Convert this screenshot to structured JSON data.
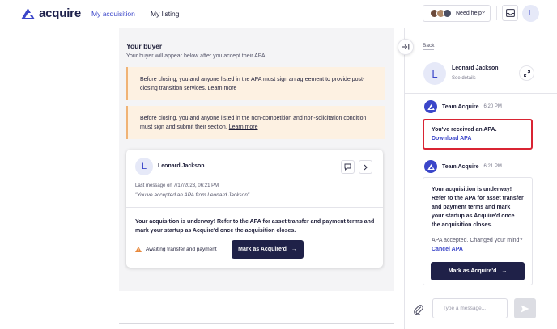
{
  "nav": {
    "brand": "acquire",
    "links": [
      {
        "label": "My acquisition",
        "active": true
      },
      {
        "label": "My listing",
        "active": false
      }
    ],
    "help_label": "Need help?",
    "user_initial": "L",
    "accent_color": "#3b46c9"
  },
  "main": {
    "title": "Your buyer",
    "subtitle": "Your buyer will appear below after you accept their APA.",
    "notices": [
      {
        "text": "Before closing, you and anyone listed in the APA must sign an agreement to provide post-closing transition services.",
        "link": "Learn more"
      },
      {
        "text": "Before closing, you and anyone listed in the non-competition and non-solicitation condition must sign and submit their section.",
        "link": "Learn more"
      }
    ],
    "buyer_card": {
      "initial": "L",
      "name": "Leonard Jackson",
      "last_message": "Last message on 7/17/2023, 06:21 PM",
      "quote": "\"You've accepted an APA from Leonard Jackson\"",
      "body": "Your acquisition is underway! Refer to the APA for asset transfer and payment terms and mark your startup as Acquire'd once the acquisition closes.",
      "status": "Awaiting transfer and payment",
      "cta": "Mark as Acquire'd"
    }
  },
  "panel": {
    "back": "Back",
    "contact": {
      "initial": "L",
      "name": "Leonard Jackson",
      "details": "See details"
    },
    "messages": [
      {
        "sender": "Team Acquire",
        "time": "6:20 PM",
        "text": "You've received an APA.",
        "link": "Download APA"
      },
      {
        "sender": "Team Acquire",
        "time": "6:21 PM",
        "text": "Your acquisition is underway! Refer to the APA for asset transfer and payment terms and mark your startup as Acquire'd once the acquisition closes.",
        "sub": "APA accepted. Changed your mind?",
        "sub_link": "Cancel APA",
        "cta": "Mark as Acquire'd"
      }
    ],
    "composer": {
      "placeholder": "Type a message...",
      "value": ""
    }
  }
}
